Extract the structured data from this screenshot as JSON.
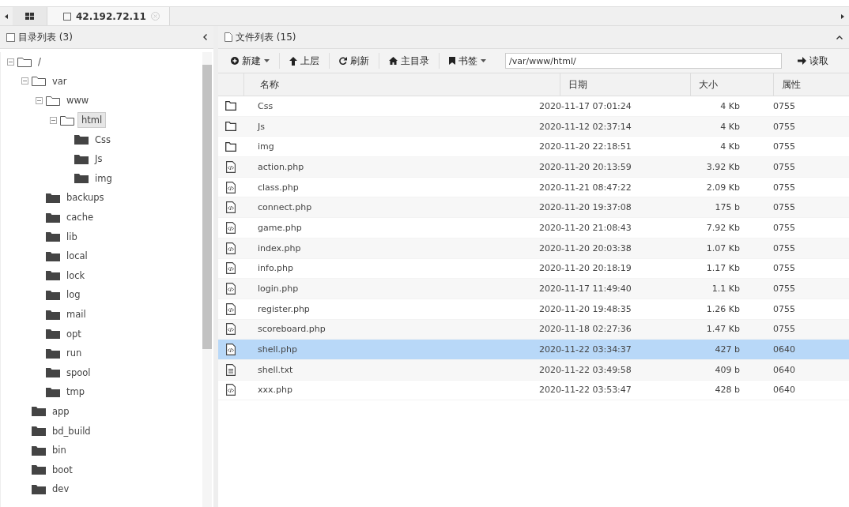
{
  "tabs": [
    {
      "kind": "grid",
      "selected": false
    },
    {
      "kind": "host",
      "label": "42.192.72.11",
      "selected": true
    }
  ],
  "directory_panel": {
    "title": "目录列表 (3)",
    "tree": [
      {
        "name": "/",
        "expanded": true,
        "selected": false,
        "children": [
          {
            "name": "var",
            "expanded": true,
            "selected": false,
            "children": [
              {
                "name": "www",
                "expanded": true,
                "selected": false,
                "children": [
                  {
                    "name": "html",
                    "expanded": true,
                    "selected": true,
                    "children": [
                      {
                        "name": "Css",
                        "expanded": false,
                        "selected": false
                      },
                      {
                        "name": "Js",
                        "expanded": false,
                        "selected": false
                      },
                      {
                        "name": "img",
                        "expanded": false,
                        "selected": false
                      }
                    ]
                  }
                ]
              },
              {
                "name": "backups",
                "expanded": false,
                "selected": false
              },
              {
                "name": "cache",
                "expanded": false,
                "selected": false
              },
              {
                "name": "lib",
                "expanded": false,
                "selected": false
              },
              {
                "name": "local",
                "expanded": false,
                "selected": false
              },
              {
                "name": "lock",
                "expanded": false,
                "selected": false
              },
              {
                "name": "log",
                "expanded": false,
                "selected": false
              },
              {
                "name": "mail",
                "expanded": false,
                "selected": false
              },
              {
                "name": "opt",
                "expanded": false,
                "selected": false
              },
              {
                "name": "run",
                "expanded": false,
                "selected": false
              },
              {
                "name": "spool",
                "expanded": false,
                "selected": false
              },
              {
                "name": "tmp",
                "expanded": false,
                "selected": false
              }
            ]
          },
          {
            "name": "app",
            "expanded": false,
            "selected": false
          },
          {
            "name": "bd_build",
            "expanded": false,
            "selected": false
          },
          {
            "name": "bin",
            "expanded": false,
            "selected": false
          },
          {
            "name": "boot",
            "expanded": false,
            "selected": false
          },
          {
            "name": "dev",
            "expanded": false,
            "selected": false
          }
        ]
      }
    ]
  },
  "file_panel": {
    "title": "文件列表 (15)",
    "toolbar": [
      {
        "kind": "new",
        "label": "新建",
        "dropdown": true
      },
      {
        "kind": "up",
        "label": "上层",
        "dropdown": false
      },
      {
        "kind": "refresh",
        "label": "刷新",
        "dropdown": false
      },
      {
        "kind": "home",
        "label": "主目录",
        "dropdown": false
      },
      {
        "kind": "bookmark",
        "label": "书签",
        "dropdown": true
      }
    ],
    "path": "/var/www/html/",
    "read_button": "读取",
    "columns": [
      "名称",
      "日期",
      "大小",
      "属性"
    ],
    "rows": [
      {
        "kind": "folder",
        "name": "Css",
        "date": "2020-11-17 07:01:24",
        "size": "4 Kb",
        "mode": "0755",
        "selected": false
      },
      {
        "kind": "folder",
        "name": "Js",
        "date": "2020-11-12 02:37:14",
        "size": "4 Kb",
        "mode": "0755",
        "selected": false
      },
      {
        "kind": "folder",
        "name": "img",
        "date": "2020-11-20 22:18:51",
        "size": "4 Kb",
        "mode": "0755",
        "selected": false
      },
      {
        "kind": "code",
        "name": "action.php",
        "date": "2020-11-20 20:13:59",
        "size": "3.92 Kb",
        "mode": "0755",
        "selected": false
      },
      {
        "kind": "code",
        "name": "class.php",
        "date": "2020-11-21 08:47:22",
        "size": "2.09 Kb",
        "mode": "0755",
        "selected": false
      },
      {
        "kind": "code",
        "name": "connect.php",
        "date": "2020-11-20 19:37:08",
        "size": "175 b",
        "mode": "0755",
        "selected": false
      },
      {
        "kind": "code",
        "name": "game.php",
        "date": "2020-11-20 21:08:43",
        "size": "7.92 Kb",
        "mode": "0755",
        "selected": false
      },
      {
        "kind": "code",
        "name": "index.php",
        "date": "2020-11-20 20:03:38",
        "size": "1.07 Kb",
        "mode": "0755",
        "selected": false
      },
      {
        "kind": "code",
        "name": "info.php",
        "date": "2020-11-20 20:18:19",
        "size": "1.17 Kb",
        "mode": "0755",
        "selected": false
      },
      {
        "kind": "code",
        "name": "login.php",
        "date": "2020-11-17 11:49:40",
        "size": "1.1 Kb",
        "mode": "0755",
        "selected": false
      },
      {
        "kind": "code",
        "name": "register.php",
        "date": "2020-11-20 19:48:35",
        "size": "1.26 Kb",
        "mode": "0755",
        "selected": false
      },
      {
        "kind": "code",
        "name": "scoreboard.php",
        "date": "2020-11-18 02:27:36",
        "size": "1.47 Kb",
        "mode": "0755",
        "selected": false
      },
      {
        "kind": "code",
        "name": "shell.php",
        "date": "2020-11-22 03:34:37",
        "size": "427 b",
        "mode": "0640",
        "selected": true
      },
      {
        "kind": "text",
        "name": "shell.txt",
        "date": "2020-11-22 03:49:58",
        "size": "409 b",
        "mode": "0640",
        "selected": false
      },
      {
        "kind": "code",
        "name": "xxx.php",
        "date": "2020-11-22 03:53:47",
        "size": "428 b",
        "mode": "0640",
        "selected": false
      }
    ]
  }
}
